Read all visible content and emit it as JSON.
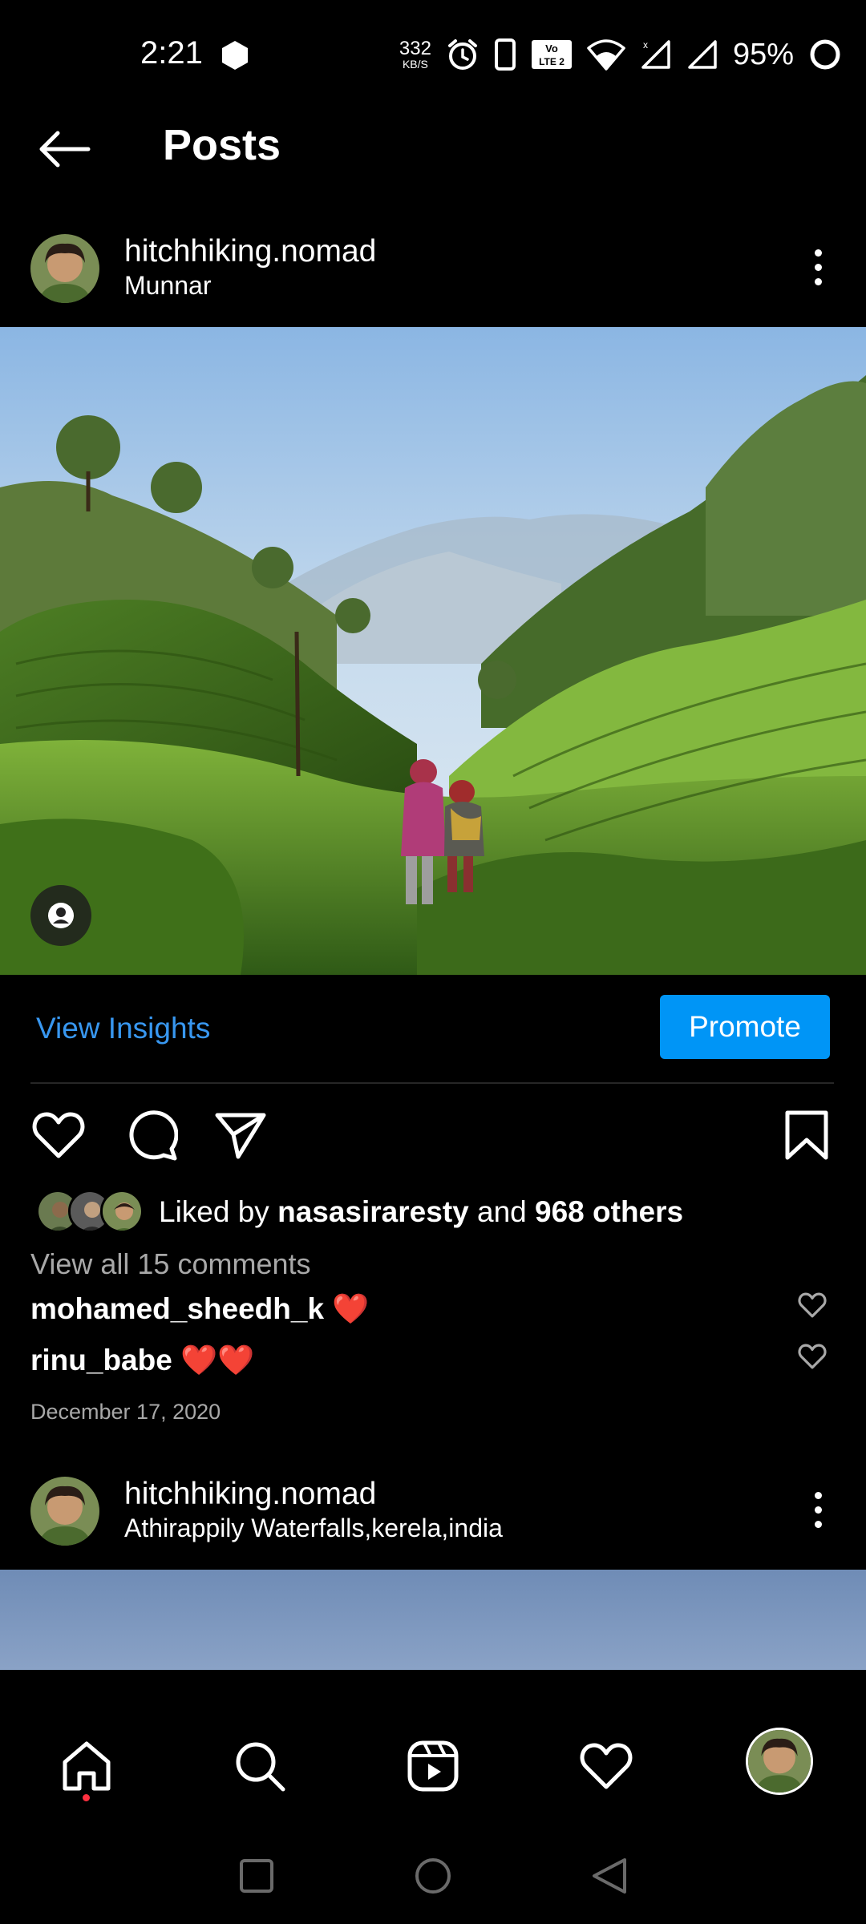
{
  "status_bar": {
    "time": "2:21",
    "net_speed": "332",
    "net_unit": "KB/S",
    "volte_line1": "Vo",
    "volte_line2": "LTE 2",
    "battery_pct": "95%"
  },
  "header": {
    "title": "Posts"
  },
  "post1": {
    "username": "hitchhiking.nomad",
    "location": "Munnar",
    "view_insights": "View Insights",
    "promote": "Promote",
    "liked_prefix": "Liked by ",
    "liked_user": "nasasiraresty",
    "liked_mid": " and ",
    "liked_others": "968 others",
    "view_comments": "View all 15 comments",
    "comments": [
      {
        "user": "mohamed_sheedh_k",
        "text": "❤️"
      },
      {
        "user": "rinu_babe",
        "text": "❤️❤️"
      }
    ],
    "date": "December 17, 2020"
  },
  "post2": {
    "username": "hitchhiking.nomad",
    "location": "Athirappily Waterfalls,kerela,india"
  },
  "icons": {
    "back": "arrow-left-icon",
    "more": "more-vertical-icon",
    "like": "heart-icon",
    "comment": "comment-icon",
    "share": "paper-plane-icon",
    "save": "bookmark-icon",
    "home": "home-icon",
    "search": "search-icon",
    "reels": "reels-icon",
    "activity": "heart-icon"
  },
  "colors": {
    "accent": "#0095f6",
    "link": "#3897f0",
    "notification_dot": "#ff3040",
    "muted": "#a8a8a8"
  }
}
